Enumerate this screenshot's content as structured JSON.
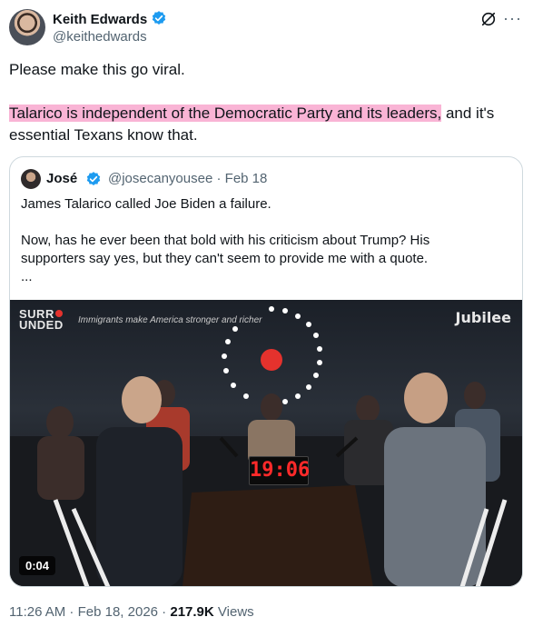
{
  "tweet": {
    "author_name": "Keith Edwards",
    "author_handle": "@keithedwards",
    "text_line1": "Please make this go viral.",
    "text_highlight": "Talarico is independent of the Democratic Party and its leaders,",
    "text_after_highlight": " and it's essential Texans know that.",
    "highlight_color": "#f9b4d5",
    "time": "11:26 AM",
    "date": "Feb 18, 2026",
    "views_count": "217.9K",
    "views_label": "Views"
  },
  "quote": {
    "author_name": "José",
    "author_handle": "@josecanyousee",
    "date": "Feb 18",
    "line1": "James Talarico called Joe Biden a failure.",
    "line2": "Now, has he ever been that bold with his criticism about Trump? His",
    "line3": "supporters say yes, but they can't seem to provide me with a quote.",
    "line4": "...",
    "video": {
      "brand_left_line1": "SURR",
      "brand_left_line2": "UNDED",
      "tagline": "Immigrants make America stronger and richer",
      "brand_right": "Jubilee",
      "timer": "19:06",
      "duration": "0:04"
    }
  },
  "icons": {
    "verified": "verified-badge-icon",
    "grok": "grok-icon",
    "more": "more-icon"
  },
  "colors": {
    "verified_blue": "#1d9bf0",
    "secondary_text": "#536471"
  }
}
